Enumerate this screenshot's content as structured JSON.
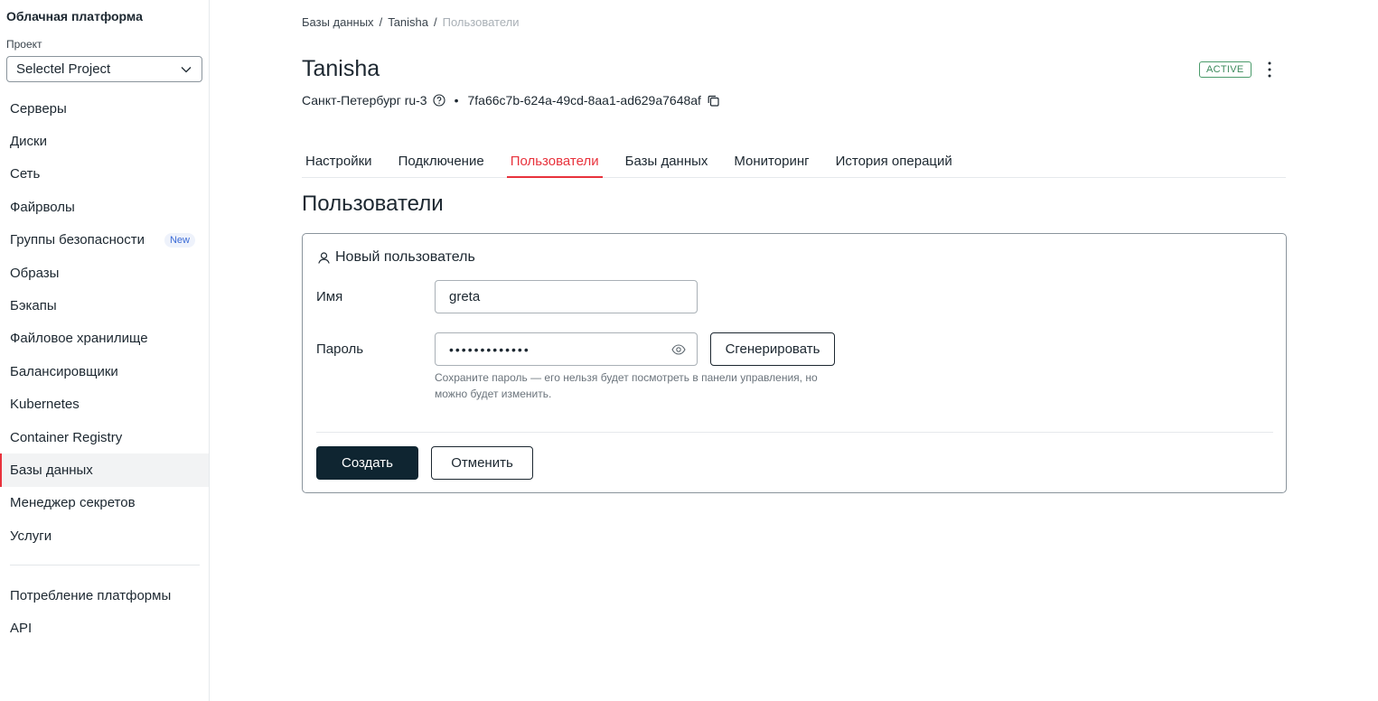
{
  "sidebar": {
    "brand": "Облачная платформа",
    "project_label": "Проект",
    "project_value": "Selectel Project",
    "items": [
      {
        "label": "Серверы"
      },
      {
        "label": "Диски"
      },
      {
        "label": "Сеть"
      },
      {
        "label": "Файрволы"
      },
      {
        "label": "Группы безопасности",
        "badge": "New"
      },
      {
        "label": "Образы"
      },
      {
        "label": "Бэкапы"
      },
      {
        "label": "Файловое хранилище"
      },
      {
        "label": "Балансировщики"
      },
      {
        "label": "Kubernetes"
      },
      {
        "label": "Container Registry"
      },
      {
        "label": "Базы данных",
        "active": true
      },
      {
        "label": "Менеджер секретов"
      },
      {
        "label": "Услуги"
      }
    ],
    "bottom_items": [
      {
        "label": "Потребление платформы"
      },
      {
        "label": "API"
      }
    ]
  },
  "breadcrumb": {
    "items": [
      "Базы данных",
      "Tanisha",
      "Пользователи"
    ],
    "separator": "/"
  },
  "header": {
    "title": "Tanisha",
    "status": "ACTIVE",
    "status_color": "#3c8a5c",
    "region": "Санкт-Петербург ru-3",
    "bullet": "•",
    "id": "7fa66c7b-624a-49cd-8aa1-ad629a7648af"
  },
  "tabs": [
    {
      "label": "Настройки"
    },
    {
      "label": "Подключение"
    },
    {
      "label": "Пользователи",
      "active": true
    },
    {
      "label": "Базы данных"
    },
    {
      "label": "Мониторинг"
    },
    {
      "label": "История операций"
    }
  ],
  "section": {
    "title": "Пользователи"
  },
  "form": {
    "title": "Новый пользователь",
    "name_label": "Имя",
    "name_value": "greta",
    "password_label": "Пароль",
    "password_value": "•••••••••••••",
    "generate_label": "Сгенерировать",
    "hint": "Сохраните пароль — его нельзя будет посмотреть в панели управления, но можно будет изменить.",
    "create_label": "Создать",
    "cancel_label": "Отменить"
  },
  "colors": {
    "accent": "#e8323c",
    "primary_button": "#0f2531",
    "new_badge": "#3b6bd6"
  },
  "icons": {
    "project_chevron": "chevron-down-icon",
    "region_help": "help-circle-icon",
    "copy": "copy-icon",
    "more": "more-vertical-icon",
    "user": "user-icon",
    "eye": "eye-icon"
  }
}
